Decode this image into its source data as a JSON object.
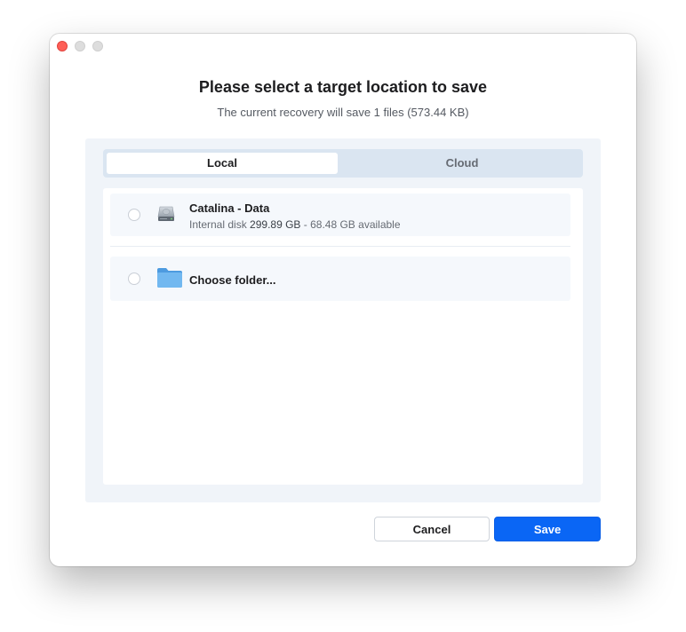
{
  "dialog": {
    "title": "Please select a target location to save",
    "subtitle": "The current recovery will save 1 files (573.44 KB)"
  },
  "tabs": [
    {
      "label": "Local",
      "selected": true
    },
    {
      "label": "Cloud",
      "selected": false
    }
  ],
  "locations": [
    {
      "title": "Catalina - Data",
      "subtitle_prefix": "Internal disk",
      "capacity": "299.89 GB",
      "subtitle_separator": "-",
      "available": "68.48 GB available",
      "icon": "hard-disk-icon",
      "selected": false
    },
    {
      "title": "Choose folder...",
      "icon": "folder-icon",
      "selected": false
    }
  ],
  "buttons": {
    "cancel": "Cancel",
    "save": "Save"
  },
  "colors": {
    "accent": "#0a66f5",
    "close": "#fe5f57",
    "folder": "#6ab4ee"
  }
}
